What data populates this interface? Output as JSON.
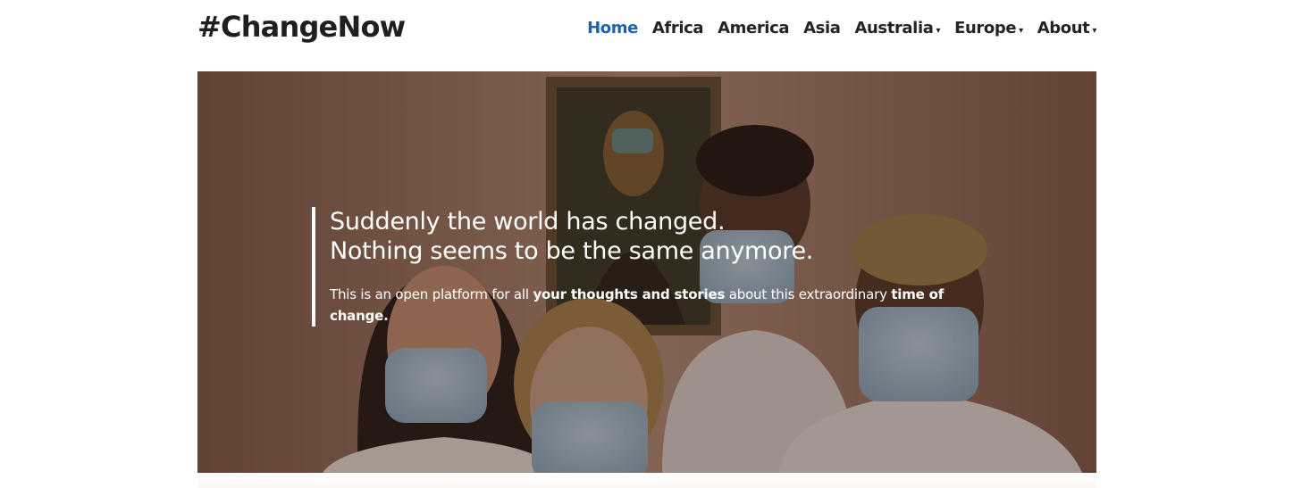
{
  "site": {
    "title": "#ChangeNow"
  },
  "nav": {
    "items": [
      {
        "label": "Home",
        "active": true,
        "dropdown": false
      },
      {
        "label": "Africa",
        "active": false,
        "dropdown": false
      },
      {
        "label": "America",
        "active": false,
        "dropdown": false
      },
      {
        "label": "Asia",
        "active": false,
        "dropdown": false
      },
      {
        "label": "Australia",
        "active": false,
        "dropdown": true
      },
      {
        "label": "Europe",
        "active": false,
        "dropdown": true
      },
      {
        "label": "About",
        "active": false,
        "dropdown": true
      }
    ],
    "caret": "▾"
  },
  "hero": {
    "headline_line1": "Suddenly the world has changed.",
    "headline_line2": "Nothing seems to be the same anymore.",
    "sub_prefix": "This is an open platform for all ",
    "sub_bold1": "your thoughts and stories",
    "sub_middle": " about this extraordinary ",
    "sub_bold2": "time of change.",
    "image_icon": "masked-people-photo"
  },
  "colors": {
    "accent": "#1d63b0",
    "text": "#242424",
    "hero_overlay": "#6a4a3c"
  }
}
